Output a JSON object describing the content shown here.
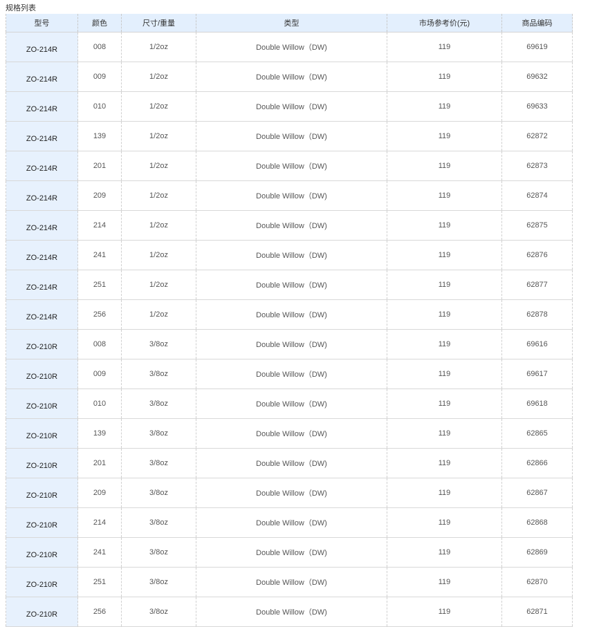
{
  "section_title": "规格列表",
  "table": {
    "headers": {
      "model": "型号",
      "color": "颜色",
      "size": "尺寸/重量",
      "type": "类型",
      "price": "市场参考价(元)",
      "code": "商品编码"
    },
    "rows": [
      {
        "model": "ZO-214R",
        "color": "008",
        "size": "1/2oz",
        "type": "Double Willow（DW)",
        "price": "119",
        "code": "69619"
      },
      {
        "model": "ZO-214R",
        "color": "009",
        "size": "1/2oz",
        "type": "Double Willow（DW)",
        "price": "119",
        "code": "69632"
      },
      {
        "model": "ZO-214R",
        "color": "010",
        "size": "1/2oz",
        "type": "Double Willow（DW)",
        "price": "119",
        "code": "69633"
      },
      {
        "model": "ZO-214R",
        "color": "139",
        "size": "1/2oz",
        "type": "Double Willow（DW)",
        "price": "119",
        "code": "62872"
      },
      {
        "model": "ZO-214R",
        "color": "201",
        "size": "1/2oz",
        "type": "Double Willow（DW)",
        "price": "119",
        "code": "62873"
      },
      {
        "model": "ZO-214R",
        "color": "209",
        "size": "1/2oz",
        "type": "Double Willow（DW)",
        "price": "119",
        "code": "62874"
      },
      {
        "model": "ZO-214R",
        "color": "214",
        "size": "1/2oz",
        "type": "Double Willow（DW)",
        "price": "119",
        "code": "62875"
      },
      {
        "model": "ZO-214R",
        "color": "241",
        "size": "1/2oz",
        "type": "Double Willow（DW)",
        "price": "119",
        "code": "62876"
      },
      {
        "model": "ZO-214R",
        "color": "251",
        "size": "1/2oz",
        "type": "Double Willow（DW)",
        "price": "119",
        "code": "62877"
      },
      {
        "model": "ZO-214R",
        "color": "256",
        "size": "1/2oz",
        "type": "Double Willow（DW)",
        "price": "119",
        "code": "62878"
      },
      {
        "model": "ZO-210R",
        "color": "008",
        "size": "3/8oz",
        "type": "Double Willow（DW)",
        "price": "119",
        "code": "69616"
      },
      {
        "model": "ZO-210R",
        "color": "009",
        "size": "3/8oz",
        "type": "Double Willow（DW)",
        "price": "119",
        "code": "69617"
      },
      {
        "model": "ZO-210R",
        "color": "010",
        "size": "3/8oz",
        "type": "Double Willow（DW)",
        "price": "119",
        "code": "69618"
      },
      {
        "model": "ZO-210R",
        "color": "139",
        "size": "3/8oz",
        "type": "Double Willow（DW)",
        "price": "119",
        "code": "62865"
      },
      {
        "model": "ZO-210R",
        "color": "201",
        "size": "3/8oz",
        "type": "Double Willow（DW)",
        "price": "119",
        "code": "62866"
      },
      {
        "model": "ZO-210R",
        "color": "209",
        "size": "3/8oz",
        "type": "Double Willow（DW)",
        "price": "119",
        "code": "62867"
      },
      {
        "model": "ZO-210R",
        "color": "214",
        "size": "3/8oz",
        "type": "Double Willow（DW)",
        "price": "119",
        "code": "62868"
      },
      {
        "model": "ZO-210R",
        "color": "241",
        "size": "3/8oz",
        "type": "Double Willow（DW)",
        "price": "119",
        "code": "62869"
      },
      {
        "model": "ZO-210R",
        "color": "251",
        "size": "3/8oz",
        "type": "Double Willow（DW)",
        "price": "119",
        "code": "62870"
      },
      {
        "model": "ZO-210R",
        "color": "256",
        "size": "3/8oz",
        "type": "Double Willow（DW)",
        "price": "119",
        "code": "62871"
      }
    ]
  },
  "colors": {
    "header_bg": "#e3effd",
    "model_col_bg": "#e7f1fd",
    "text": "#333333"
  }
}
